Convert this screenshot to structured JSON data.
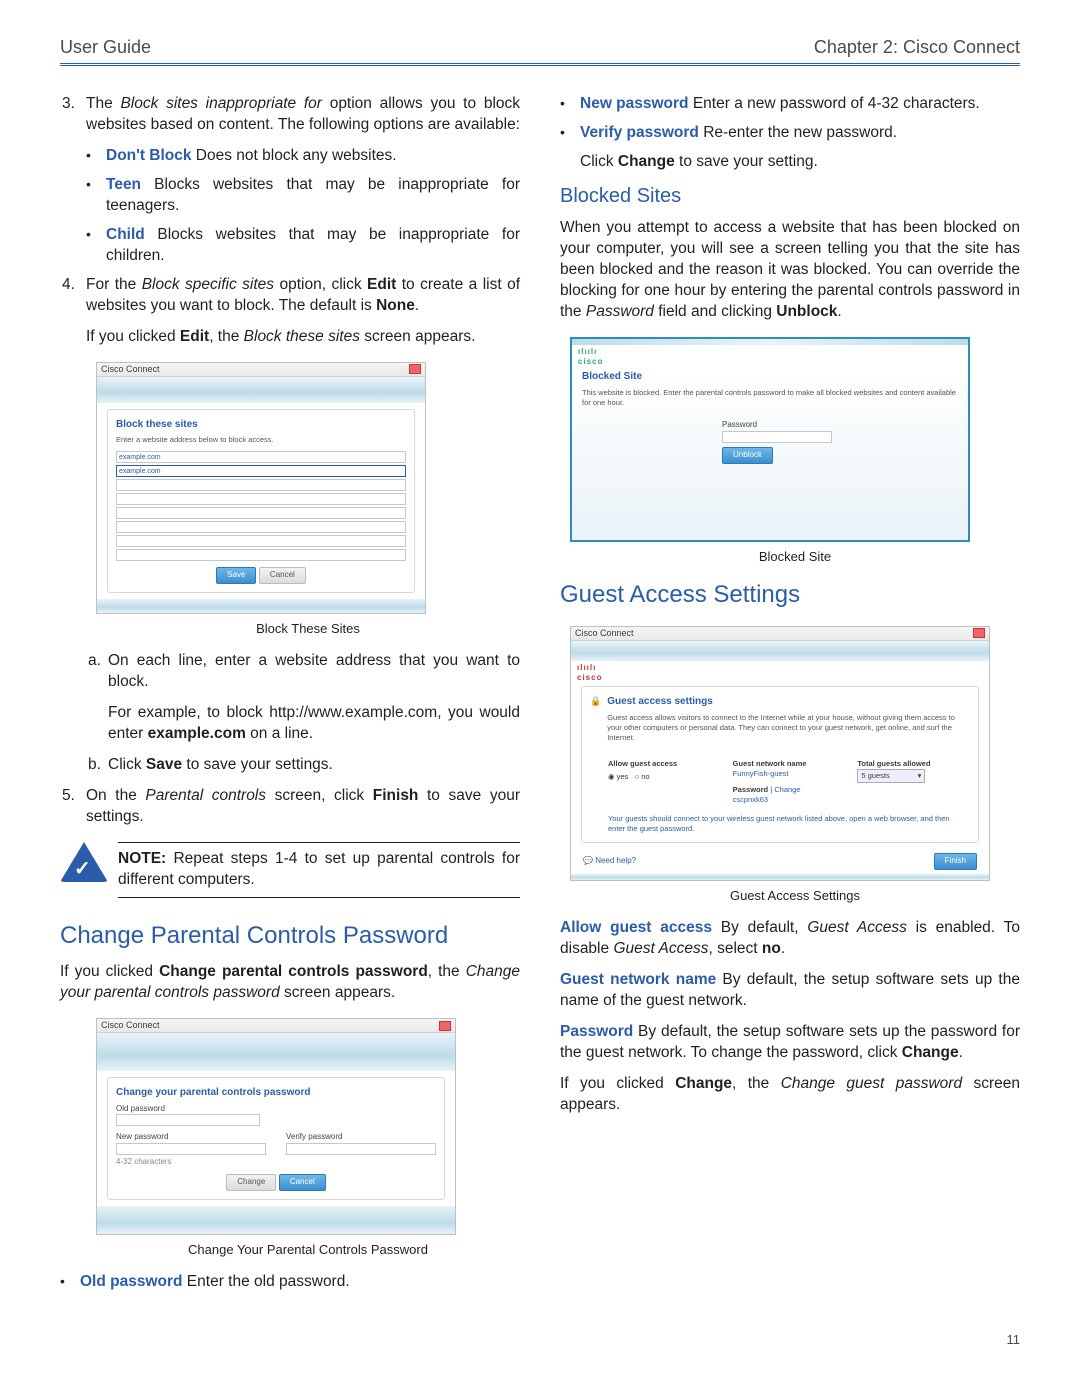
{
  "header": {
    "left": "User Guide",
    "right": "Chapter 2: Cisco Connect"
  },
  "left": {
    "item3_num": "3.",
    "item3_a": "The ",
    "item3_b": "Block sites inappropriate for",
    "item3_c": " option allows you to block websites based on content. The following options are available:",
    "opt1_term": "Don't Block",
    "opt1_rest": "  Does not block any websites.",
    "opt2_term": "Teen",
    "opt2_rest": "  Blocks websites that may be inappropriate for teenagers.",
    "opt3_term": "Child",
    "opt3_rest": "  Blocks websites that may be inappropriate for children.",
    "item4_num": "4.",
    "item4_a": "For the ",
    "item4_b": "Block specific sites",
    "item4_c": " option, click ",
    "item4_d": "Edit",
    "item4_e": " to create a list of websites you want to block. The default is ",
    "item4_f": "None",
    "item4_g": ".",
    "item4_follow_a": "If you clicked ",
    "item4_follow_b": "Edit",
    "item4_follow_c": ", the ",
    "item4_follow_d": "Block these sites",
    "item4_follow_e": " screen appears.",
    "fig1_caption": "Block These Sites",
    "sub_a_num": "a.",
    "sub_a_text": "On each line, enter a website address that you want to block.",
    "sub_a_follow_a": "For example, to block http://www.example.com, you would enter ",
    "sub_a_follow_b": "example.com",
    "sub_a_follow_c": " on a line.",
    "sub_b_num": "b.",
    "sub_b_a": "Click ",
    "sub_b_b": "Save",
    "sub_b_c": " to save your settings.",
    "item5_num": "5.",
    "item5_a": "On the ",
    "item5_b": "Parental controls",
    "item5_c": " screen, click ",
    "item5_d": "Finish",
    "item5_e": " to save your settings.",
    "note_label": "NOTE:",
    "note_text": " Repeat steps 1-4 to set up parental controls for different computers.",
    "h2_change": "Change Parental Controls Password",
    "change_a": "If you clicked ",
    "change_b": "Change parental controls password",
    "change_c": ", the ",
    "change_d": "Change your parental controls password",
    "change_e": " screen appears.",
    "fig2_caption": "Change Your Parental Controls Password",
    "old_term": "Old password",
    "old_rest": "  Enter the old password."
  },
  "right": {
    "new_term": "New password",
    "new_rest": " Enter a new password of 4-32 characters.",
    "ver_term": "Verify password",
    "ver_rest": "  Re-enter the new password.",
    "click_change_a": "Click ",
    "click_change_b": "Change",
    "click_change_c": " to save your setting.",
    "h3_blocked": "Blocked Sites",
    "blocked_a": "When you attempt to access a website that has been blocked on your computer, you will see a screen telling you that the site has been blocked and the reason it was blocked. You can override the blocking for one hour by entering the parental controls password in the ",
    "blocked_b": "Password",
    "blocked_c": " field and clicking ",
    "blocked_d": "Unblock",
    "blocked_e": ".",
    "fig3_caption": "Blocked Site",
    "h2_guest": "Guest Access Settings",
    "fig4_caption": "Guest Access Settings",
    "allow_term": "Allow guest access",
    "allow_a": "  By default, ",
    "allow_b": "Guest Access",
    "allow_c": " is enabled. To disable ",
    "allow_d": "Guest Access",
    "allow_e": ", select ",
    "allow_f": "no",
    "allow_g": ".",
    "gname_term": "Guest network name",
    "gname_rest": "  By default, the setup software sets up the name of the guest network.",
    "pass_term": "Password",
    "pass_a": " By default, the setup software sets up the password for the guest network. To change the password, click ",
    "pass_b": "Change",
    "pass_c": ".",
    "ifchange_a": "If you clicked ",
    "ifchange_b": "Change",
    "ifchange_c": ", the ",
    "ifchange_d": "Change guest password",
    "ifchange_e": " screen appears."
  },
  "mock1": {
    "title": "Cisco Connect",
    "heading": "Block these sites",
    "sub": "Enter a website address below to block access.",
    "row1": "example.com",
    "row2": "example.com",
    "btn_save": "Save",
    "btn_cancel": "Cancel"
  },
  "mock2": {
    "title": "Cisco Connect",
    "heading": "Change your parental controls password",
    "lbl_old": "Old password",
    "lbl_new": "New password",
    "lbl_verify": "Verify password",
    "hint": "4-32 characters",
    "btn_change": "Change",
    "btn_cancel": "Cancel"
  },
  "mock3": {
    "cisco": "cisco",
    "heading": "Blocked Site",
    "sub": "This website is blocked. Enter the parental controls password to make all blocked websites and content available for one hour.",
    "lbl_pass": "Password",
    "btn": "Unblock"
  },
  "mock4": {
    "title": "Cisco Connect",
    "cisco": "cisco",
    "heading": "Guest access settings",
    "sub": "Guest access allows visitors to connect to the Internet while at your house, without giving them access to your other computers or personal data. They can connect to your guest network, get online, and surf the Internet.",
    "col1": "Allow guest access",
    "yes": "yes",
    "no": "no",
    "col2": "Guest network name",
    "gname": "FunnyFish-guest",
    "pwlabel": "Password",
    "changelnk": "Change",
    "pwval": "cscpnxk63",
    "col3": "Total guests allowed",
    "guests": "5 guests",
    "foot": "Your guests should connect to your wireless guest network listed above, open a web browser, and then enter the guest password.",
    "need": "Need help?",
    "finish": "Finish"
  },
  "page_number": "11"
}
